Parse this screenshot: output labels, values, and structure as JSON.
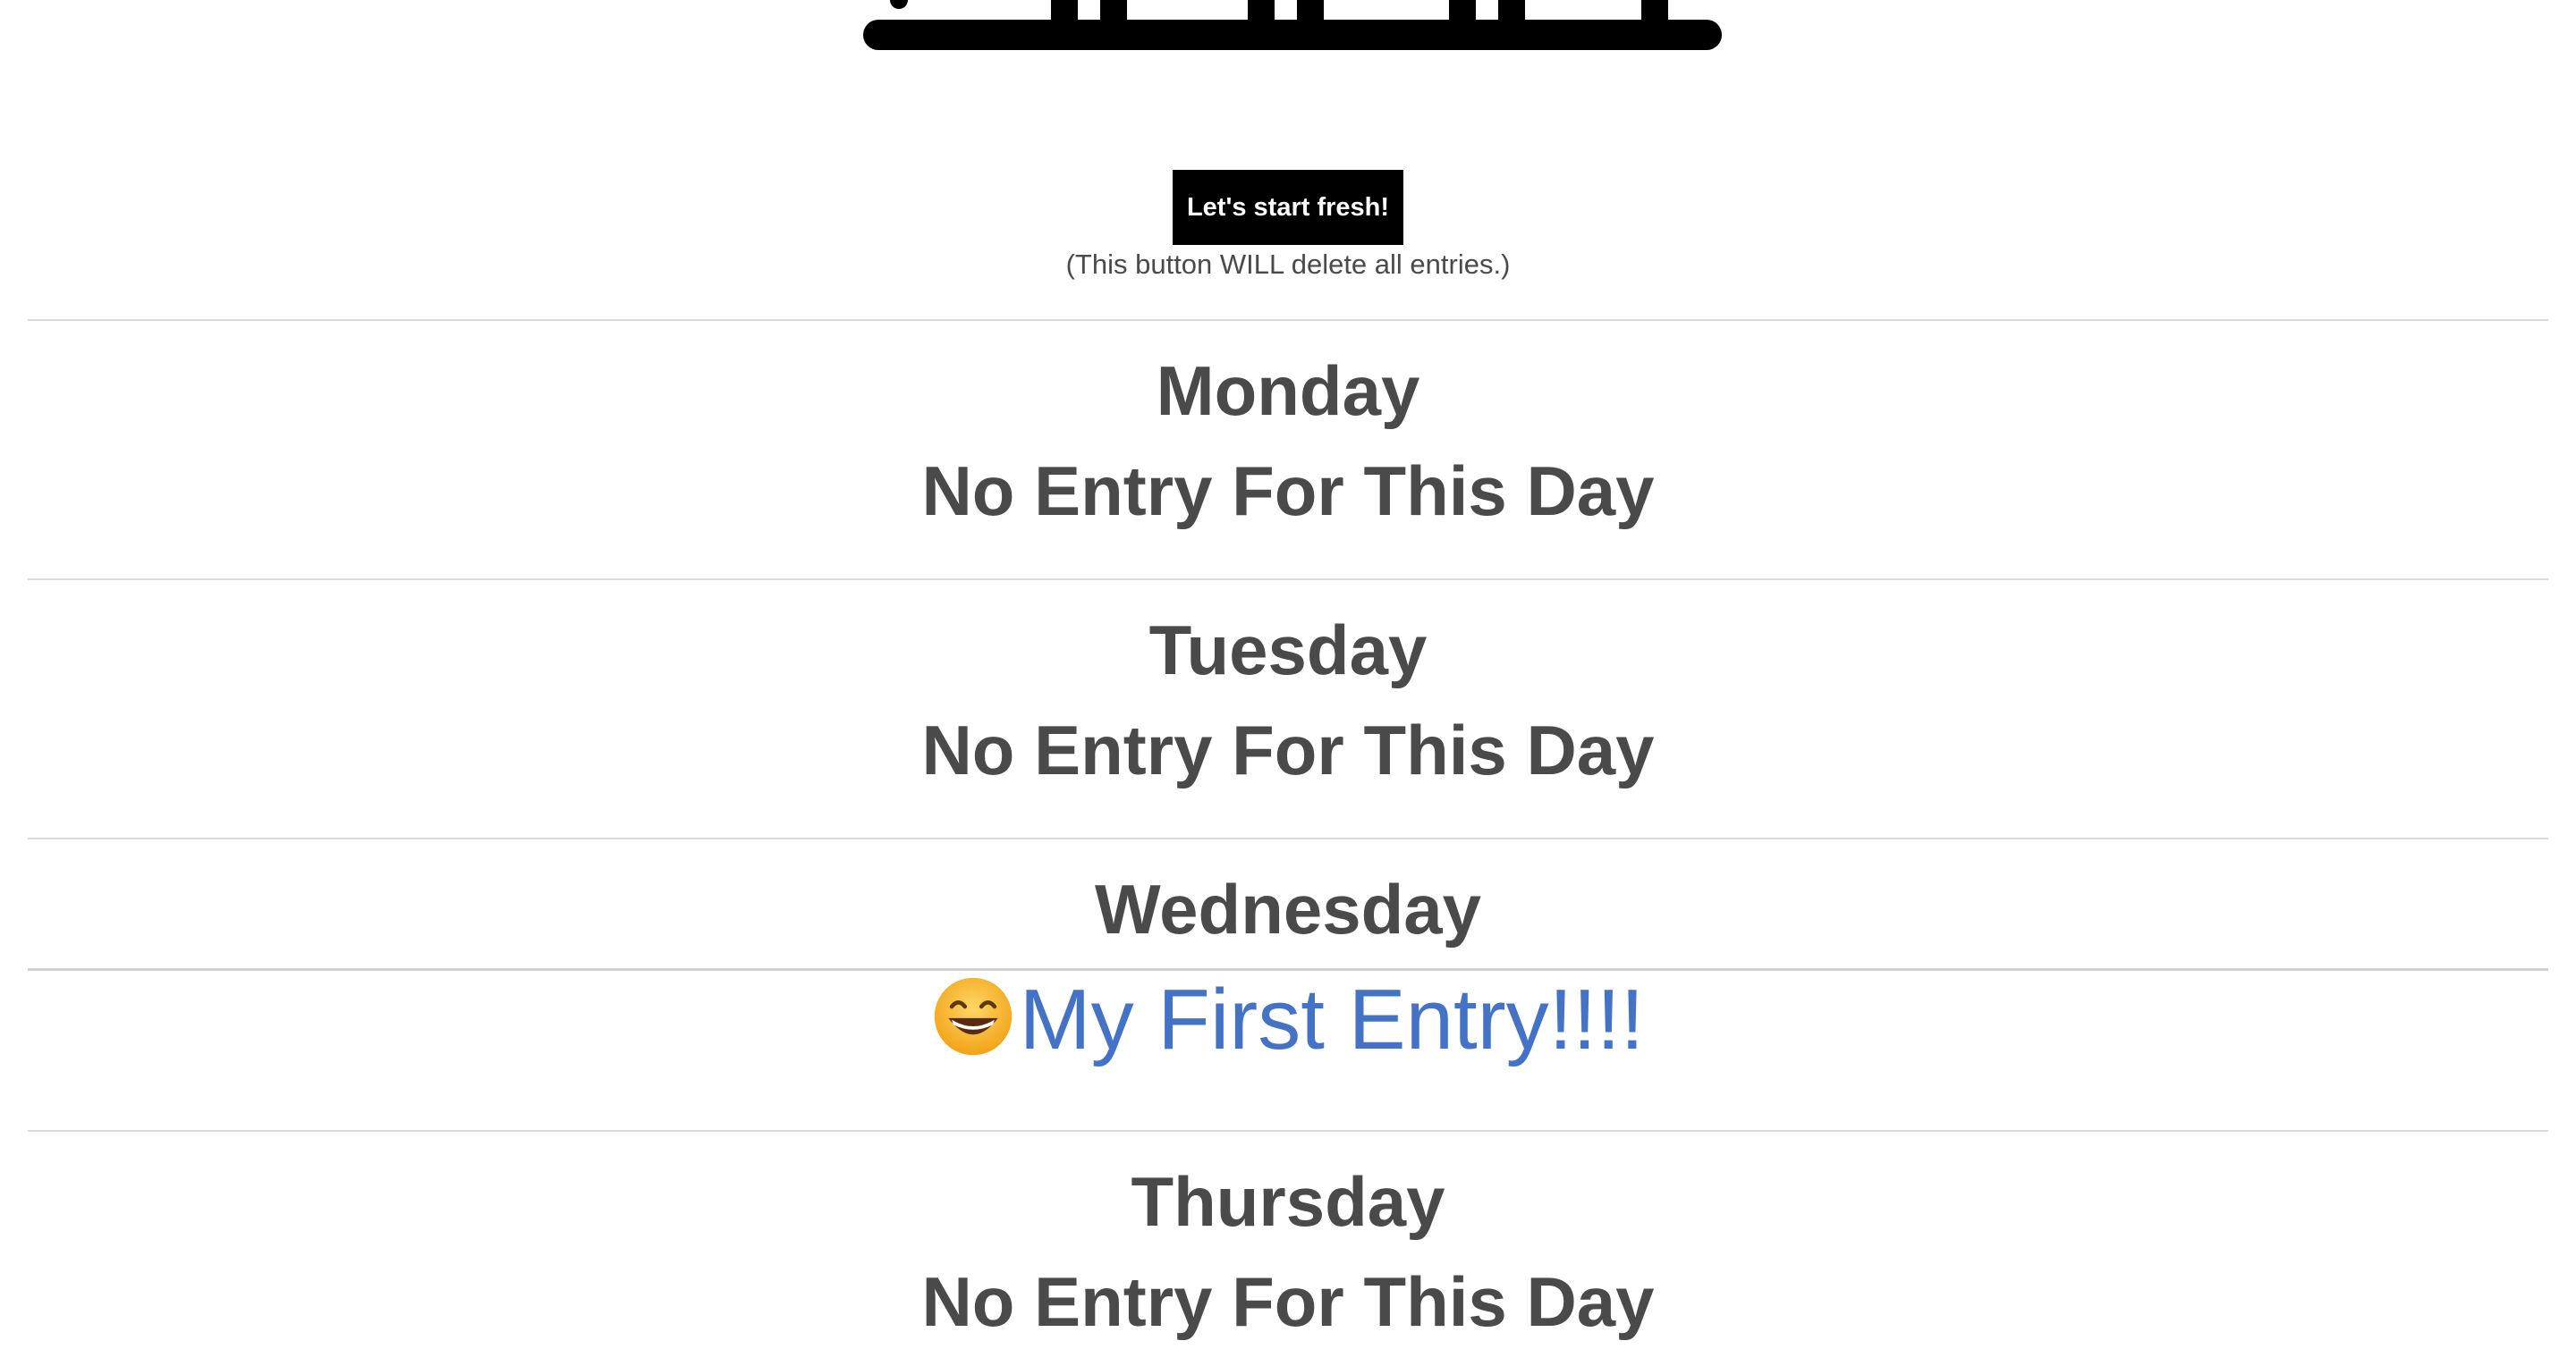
{
  "header": {
    "logo_icon": "bookshelf-logo-icon"
  },
  "reset": {
    "button_label": "Let's start fresh!",
    "note": "(This button WILL delete all entries.)"
  },
  "days": [
    {
      "name": "Monday",
      "entry": "No Entry For This Day",
      "has_entry": false
    },
    {
      "name": "Tuesday",
      "entry": "No Entry For This Day",
      "has_entry": false
    },
    {
      "name": "Wednesday",
      "entry": "My First Entry!!!!",
      "has_entry": true,
      "entry_icon": "grinning-face-icon",
      "entry_color": "#4472c4"
    },
    {
      "name": "Thursday",
      "entry": "No Entry For This Day",
      "has_entry": false
    }
  ],
  "colors": {
    "text": "#4a4a4a",
    "button_bg": "#000000",
    "button_text": "#ffffff",
    "link": "#4472c4",
    "divider": "#dcdcdc"
  }
}
